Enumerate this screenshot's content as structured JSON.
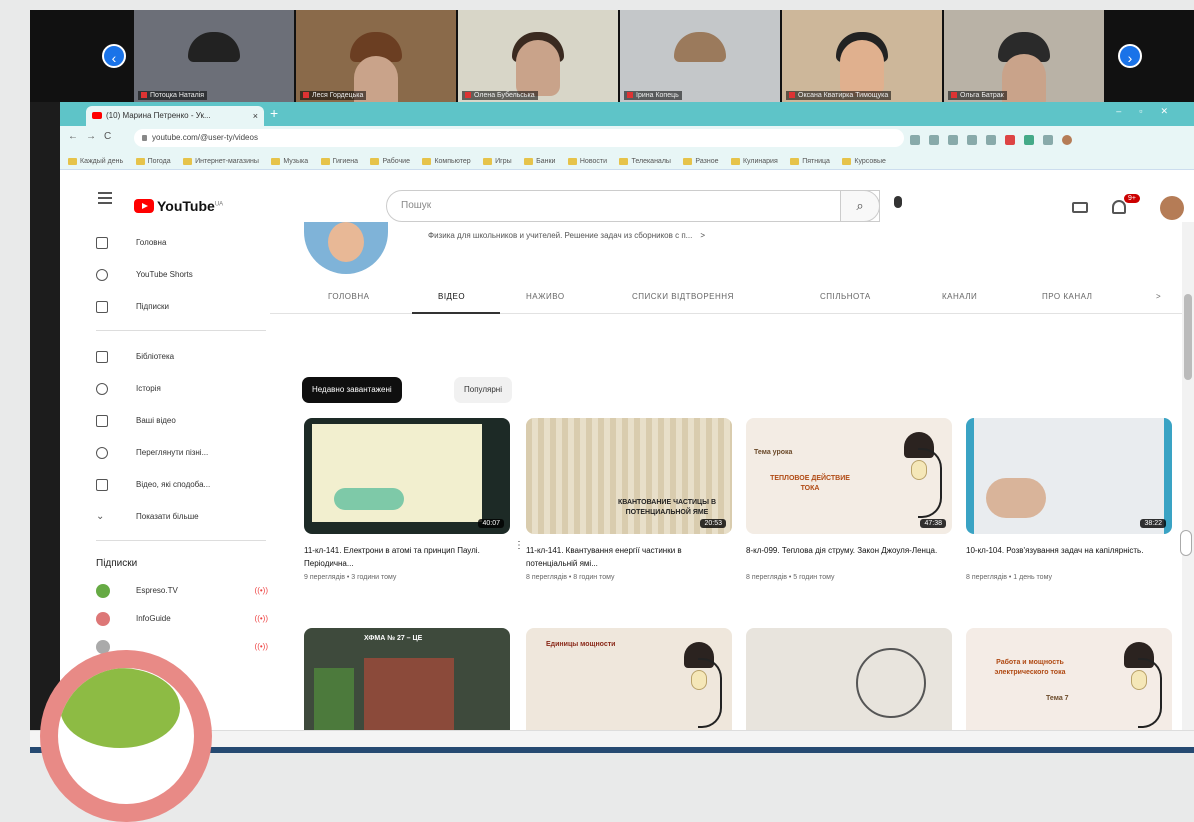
{
  "video_strip": {
    "participants": [
      {
        "name": "Потоцка Наталія"
      },
      {
        "name": "Леся Гордецька"
      },
      {
        "name": "Олена Бубельська"
      },
      {
        "name": "Ірина Копець"
      },
      {
        "name": "Оксана Кватирка Тимощука"
      },
      {
        "name": "Ольга Батрак"
      }
    ],
    "prev_icon": "chevron-left-icon",
    "next_icon": "chevron-right-icon"
  },
  "browser": {
    "tab_title": "(10) Марина Петренко - Ук...",
    "tab_close": "×",
    "new_tab": "+",
    "url": "youtube.com/@user-ty/videos",
    "bookmarks": [
      "Каждый день",
      "Погода",
      "Интернет-магазины",
      "Музыка",
      "Гигиена",
      "Рабочие",
      "Компьютер",
      "Игры",
      "Банки",
      "Новости",
      "Телеканалы",
      "Разное",
      "Кулинария",
      "Пятница",
      "Курсовые"
    ]
  },
  "youtube": {
    "logo_text": "YouTube",
    "region": "UA",
    "search_placeholder": "Пошук",
    "notification_count": "9+",
    "sidebar": {
      "main": [
        {
          "label": "Головна",
          "icon": "home-icon"
        },
        {
          "label": "YouTube Shorts",
          "icon": "shorts-icon"
        },
        {
          "label": "Підписки",
          "icon": "subscriptions-icon"
        }
      ],
      "library": [
        {
          "label": "Бібліотека",
          "icon": "library-icon"
        },
        {
          "label": "Історія",
          "icon": "history-icon"
        },
        {
          "label": "Ваші відео",
          "icon": "your-videos-icon"
        },
        {
          "label": "Переглянути пізні...",
          "icon": "watch-later-icon"
        },
        {
          "label": "Відео, які сподоба...",
          "icon": "like-icon"
        },
        {
          "label": "Показати більше",
          "icon": "chevron-down-icon"
        }
      ],
      "subscriptions_heading": "Підписки",
      "subscriptions": [
        {
          "label": "Espreso.TV",
          "live": "((•))"
        },
        {
          "label": "InfoGuide",
          "live": "((•))"
        },
        {
          "label": "",
          "live": "((•))"
        }
      ]
    },
    "channel": {
      "description": "Физика для школьников и учителей. Решение задач из сборников с п...",
      "more": ">"
    },
    "tabs": [
      "ГОЛОВНА",
      "ВІДЕО",
      "НАЖИВО",
      "СПИСКИ ВІДТВОРЕННЯ",
      "СПІЛЬНОТА",
      "КАНАЛИ",
      "ПРО КАНАЛ",
      ">"
    ],
    "active_tab": "ВІДЕО",
    "chips": [
      "Недавно завантажені",
      "Популярні"
    ],
    "videos": [
      {
        "title": "11-кл-141. Електрони в атомі та принцип Паулі. Періодична...",
        "meta": "9 переглядів • 3 години тому",
        "duration": "40:07"
      },
      {
        "title": "11-кл-141. Квантування енергії частинки в потенціальній ямі...",
        "meta": "8 переглядів • 8 годин тому",
        "duration": "20:53"
      },
      {
        "title": "8-кл-099. Теплова дія струму. Закон Джоуля-Ленца.",
        "meta": "8 переглядів • 5 годин тому",
        "duration": "47:38"
      },
      {
        "title": "10-кл-104. Розв'язування задач на капілярність.",
        "meta": "8 переглядів • 1 день тому",
        "duration": "38:22"
      }
    ],
    "thumb_texts": {
      "v2": "КВАНТОВАНИЕ ЧАСТИЦЫ В ПОТЕНЦИАЛЬНОЙ ЯМЕ",
      "v3_a": "Тема урока",
      "v3_b": "ТЕПЛОВОЕ ДЕЙСТВИЕ ТОКА",
      "r2_1": "ХФМА № 27 – ЦЕ",
      "r2_2": "Единицы мощности",
      "r2_4_a": "Работа и мощность электрического тока",
      "r2_4_b": "Тема 7"
    }
  }
}
